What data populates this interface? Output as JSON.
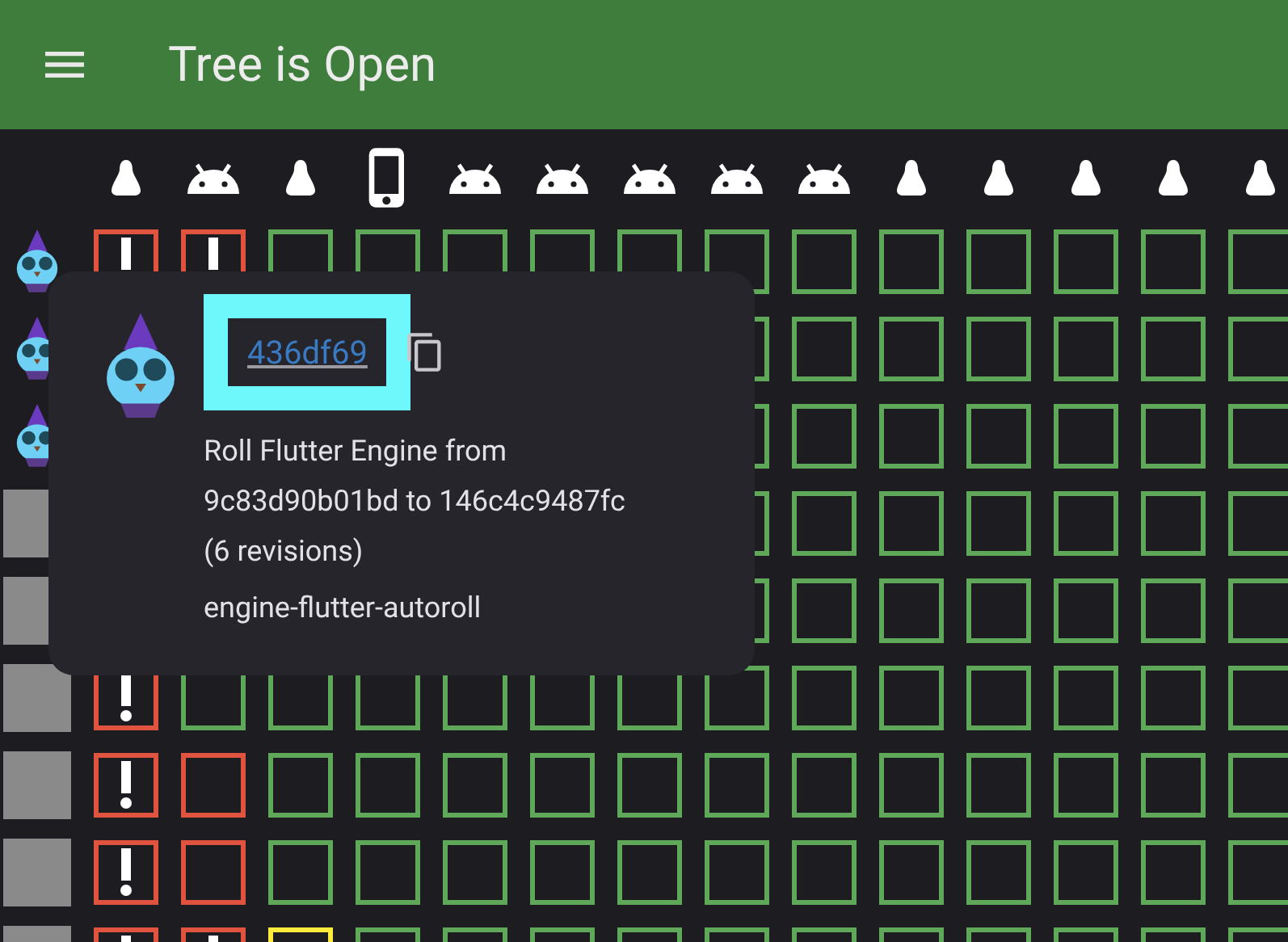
{
  "app_bar": {
    "title": "Tree is Open"
  },
  "platforms": [
    {
      "kind": "linux"
    },
    {
      "kind": "android"
    },
    {
      "kind": "linux"
    },
    {
      "kind": "ios"
    },
    {
      "kind": "android"
    },
    {
      "kind": "android"
    },
    {
      "kind": "android"
    },
    {
      "kind": "android"
    },
    {
      "kind": "android"
    },
    {
      "kind": "linux"
    },
    {
      "kind": "linux"
    },
    {
      "kind": "linux"
    },
    {
      "kind": "linux"
    },
    {
      "kind": "linux"
    }
  ],
  "commits": [
    {
      "avatar": {
        "kind": "bot"
      },
      "tasks": [
        {
          "kind": "failed_alert"
        },
        {
          "kind": "failed_alert"
        },
        {
          "kind": "succeeded"
        },
        {
          "kind": "succeeded"
        },
        {
          "kind": "succeeded"
        },
        {
          "kind": "succeeded"
        },
        {
          "kind": "succeeded"
        },
        {
          "kind": "succeeded"
        },
        {
          "kind": "succeeded"
        },
        {
          "kind": "succeeded"
        },
        {
          "kind": "succeeded"
        },
        {
          "kind": "succeeded"
        },
        {
          "kind": "succeeded"
        },
        {
          "kind": "succeeded"
        }
      ]
    },
    {
      "avatar": {
        "kind": "bot"
      },
      "tasks": [
        {
          "kind": "succeeded"
        },
        {
          "kind": "succeeded"
        },
        {
          "kind": "succeeded"
        },
        {
          "kind": "succeeded"
        },
        {
          "kind": "succeeded"
        },
        {
          "kind": "succeeded"
        },
        {
          "kind": "succeeded"
        }
      ]
    },
    {
      "avatar": {
        "kind": "bot"
      },
      "tasks": [
        {
          "kind": "succeeded"
        },
        {
          "kind": "succeeded"
        },
        {
          "kind": "succeeded"
        },
        {
          "kind": "succeeded"
        },
        {
          "kind": "succeeded"
        },
        {
          "kind": "succeeded"
        },
        {
          "kind": "succeeded"
        }
      ]
    },
    {
      "avatar": {
        "kind": "photo"
      },
      "tasks": [
        {
          "kind": "succeeded"
        },
        {
          "kind": "succeeded"
        },
        {
          "kind": "succeeded"
        },
        {
          "kind": "succeeded"
        },
        {
          "kind": "succeeded"
        },
        {
          "kind": "succeeded"
        },
        {
          "kind": "succeeded"
        }
      ]
    },
    {
      "avatar": {
        "kind": "photo"
      },
      "tasks": [
        {
          "kind": "succeeded"
        },
        {
          "kind": "succeeded"
        },
        {
          "kind": "succeeded"
        },
        {
          "kind": "succeeded"
        },
        {
          "kind": "succeeded"
        },
        {
          "kind": "succeeded"
        },
        {
          "kind": "succeeded"
        }
      ]
    },
    {
      "avatar": {
        "kind": "photo"
      },
      "tasks": [
        {
          "kind": "failed_alert"
        },
        {
          "kind": "succeeded"
        },
        {
          "kind": "succeeded"
        },
        {
          "kind": "succeeded"
        },
        {
          "kind": "succeeded"
        },
        {
          "kind": "succeeded"
        },
        {
          "kind": "succeeded"
        },
        {
          "kind": "succeeded"
        },
        {
          "kind": "succeeded"
        },
        {
          "kind": "succeeded"
        },
        {
          "kind": "succeeded"
        },
        {
          "kind": "succeeded"
        },
        {
          "kind": "succeeded"
        },
        {
          "kind": "succeeded"
        }
      ]
    },
    {
      "avatar": {
        "kind": "photo"
      },
      "tasks": [
        {
          "kind": "failed_alert"
        },
        {
          "kind": "failed"
        },
        {
          "kind": "succeeded"
        },
        {
          "kind": "succeeded"
        },
        {
          "kind": "succeeded"
        },
        {
          "kind": "succeeded"
        },
        {
          "kind": "succeeded"
        },
        {
          "kind": "succeeded"
        },
        {
          "kind": "succeeded"
        },
        {
          "kind": "succeeded"
        },
        {
          "kind": "succeeded"
        },
        {
          "kind": "succeeded"
        },
        {
          "kind": "succeeded"
        },
        {
          "kind": "succeeded"
        }
      ]
    },
    {
      "avatar": {
        "kind": "photo"
      },
      "tasks": [
        {
          "kind": "failed_alert"
        },
        {
          "kind": "failed"
        },
        {
          "kind": "succeeded"
        },
        {
          "kind": "succeeded"
        },
        {
          "kind": "succeeded"
        },
        {
          "kind": "succeeded"
        },
        {
          "kind": "succeeded"
        },
        {
          "kind": "succeeded"
        },
        {
          "kind": "succeeded"
        },
        {
          "kind": "succeeded"
        },
        {
          "kind": "succeeded"
        },
        {
          "kind": "succeeded"
        },
        {
          "kind": "succeeded"
        },
        {
          "kind": "succeeded"
        }
      ]
    },
    {
      "avatar": {
        "kind": "photo"
      },
      "tasks": [
        {
          "kind": "failed_alert"
        },
        {
          "kind": "failed_alert"
        },
        {
          "kind": "in_progress"
        },
        {
          "kind": "succeeded"
        },
        {
          "kind": "succeeded"
        },
        {
          "kind": "succeeded"
        },
        {
          "kind": "succeeded"
        },
        {
          "kind": "succeeded"
        },
        {
          "kind": "succeeded"
        },
        {
          "kind": "succeeded"
        },
        {
          "kind": "succeeded"
        },
        {
          "kind": "succeeded"
        },
        {
          "kind": "succeeded"
        },
        {
          "kind": "succeeded"
        }
      ]
    }
  ],
  "commit_popup": {
    "avatar": {
      "kind": "bot"
    },
    "sha": "436df69",
    "message": "Roll Flutter Engine from 9c83d90b01bd to 146c4c9487fc (6 revisions)",
    "author": "engine-flutter-autoroll"
  }
}
